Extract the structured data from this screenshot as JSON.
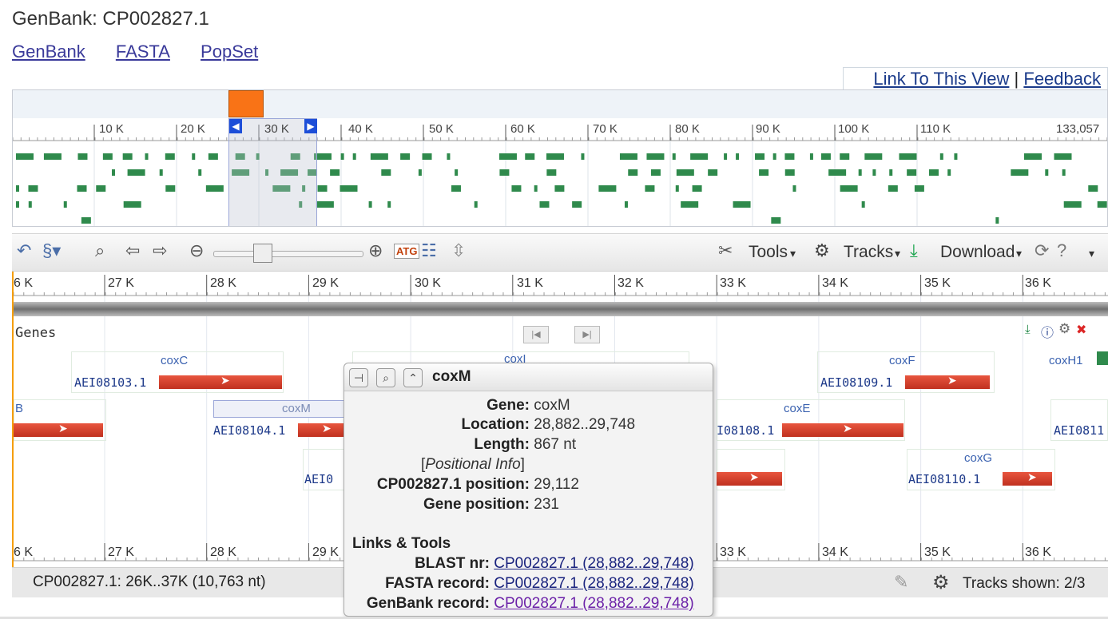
{
  "page": {
    "title": "GenBank: CP002827.1"
  },
  "tabs": [
    "GenBank",
    "FASTA",
    "PopSet"
  ],
  "links": {
    "link_view": "Link To This View",
    "sep": "|",
    "feedback": "Feedback"
  },
  "overview": {
    "ticks": [
      "10 K",
      "20 K",
      "30 K",
      "40 K",
      "50 K",
      "60 K",
      "70 K",
      "80 K",
      "90 K",
      "100 K",
      "110 K"
    ],
    "end_label": "133,057"
  },
  "toolbar": {
    "tools": "Tools",
    "tracks": "Tracks",
    "download": "Download"
  },
  "ruler": [
    "6 K",
    "27 K",
    "28 K",
    "29 K",
    "30 K",
    "31 K",
    "32 K",
    "33 K",
    "34 K",
    "35 K",
    "36 K"
  ],
  "ruler_bottom": [
    "6 K",
    "27 K",
    "28 K",
    "29 K",
    "33 K",
    "34 K",
    "35 K",
    "36 K"
  ],
  "track": {
    "label": "Genes"
  },
  "genes": [
    {
      "name": "coxC",
      "id": "AEI08103.1"
    },
    {
      "name": "coxI",
      "id": ""
    },
    {
      "name": "coxF",
      "id": "AEI08109.1"
    },
    {
      "name": "coxH1",
      "id": ""
    },
    {
      "name": "B",
      "id": ""
    },
    {
      "name": "coxM",
      "id": "AEI08104.1"
    },
    {
      "name": "coxE",
      "id": "I08108.1"
    },
    {
      "name": "",
      "id": "AEI0811"
    },
    {
      "name": "",
      "id": "AEI0"
    },
    {
      "name": "coxG",
      "id": "AEI08110.1"
    }
  ],
  "status": {
    "range": "CP002827.1: 26K..37K (10,763 nt)",
    "tracks_shown": "Tracks shown: 2/3"
  },
  "popup": {
    "title": "coxM",
    "gene_k": "Gene:",
    "gene_v": "coxM",
    "loc_k": "Location:",
    "loc_v": "28,882..29,748",
    "len_k": "Length:",
    "len_v": "867 nt",
    "pos_info": "Positional Info",
    "cp_k": "CP002827.1 position:",
    "cp_v": "29,112",
    "gp_k": "Gene position:",
    "gp_v": "231",
    "links_header": "Links & Tools",
    "blast_k": "BLAST nr:",
    "blast_v": "CP002827.1 (28,882..29,748)",
    "fasta_k": "FASTA record:",
    "fasta_v": "CP002827.1 (28,882..29,748)",
    "gb_k": "GenBank record:",
    "gb_v": "CP002827.1 (28,882..29,748)"
  }
}
